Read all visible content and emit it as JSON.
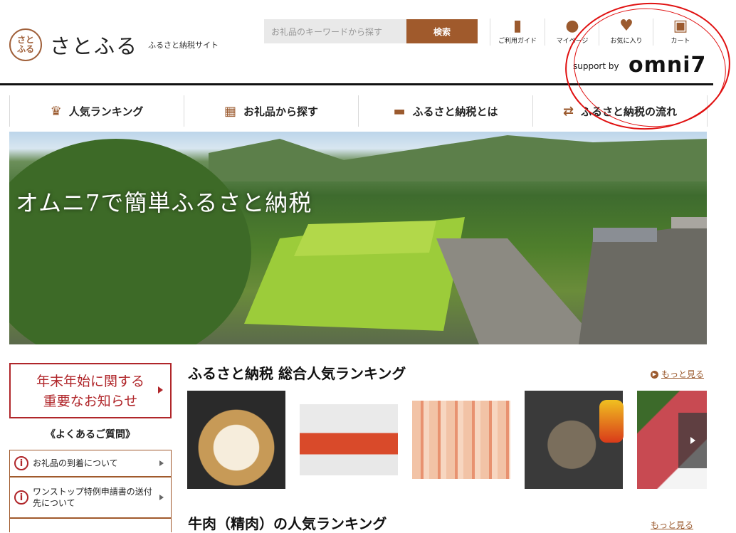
{
  "header": {
    "logo_seal": "さとふる",
    "logo_text": "さとふる",
    "logo_sub": "ふるさと納税サイト",
    "search_placeholder": "お礼品のキーワードから探す",
    "search_button": "検索",
    "icons": [
      {
        "label": "ご利用ガイド",
        "icon": "book-icon"
      },
      {
        "label": "マイページ",
        "icon": "user-icon"
      },
      {
        "label": "お気に入り",
        "icon": "heart-icon"
      },
      {
        "label": "カート",
        "icon": "cart-icon"
      }
    ],
    "support_by": "support by",
    "omni_logo": "omni7"
  },
  "nav": [
    {
      "label": "人気ランキング",
      "icon": "crown-icon"
    },
    {
      "label": "お礼品から探す",
      "icon": "gift-icon"
    },
    {
      "label": "ふるさと納税とは",
      "icon": "money-icon"
    },
    {
      "label": "ふるさと納税の流れ",
      "icon": "exchange-icon"
    }
  ],
  "hero": {
    "text": "オムニ7で簡単ふるさと納税"
  },
  "sidebar": {
    "notice_line1": "年末年始に関する",
    "notice_line2": "重要なお知らせ",
    "faq_title": "《よくあるご質問》",
    "faq": [
      {
        "label": "お礼品の到着について"
      },
      {
        "label": "ワンストップ特例申請書の送付先について"
      }
    ]
  },
  "ranking": {
    "title": "ふるさと納税 総合人気ランキング",
    "more": "もっと見る",
    "second_title": "牛肉（精肉）の人気ランキング",
    "second_more": "もっと見る"
  },
  "colors": {
    "brand_brown": "#a05a2c",
    "notice_red": "#b0262a",
    "annotation_red": "#e01010"
  }
}
